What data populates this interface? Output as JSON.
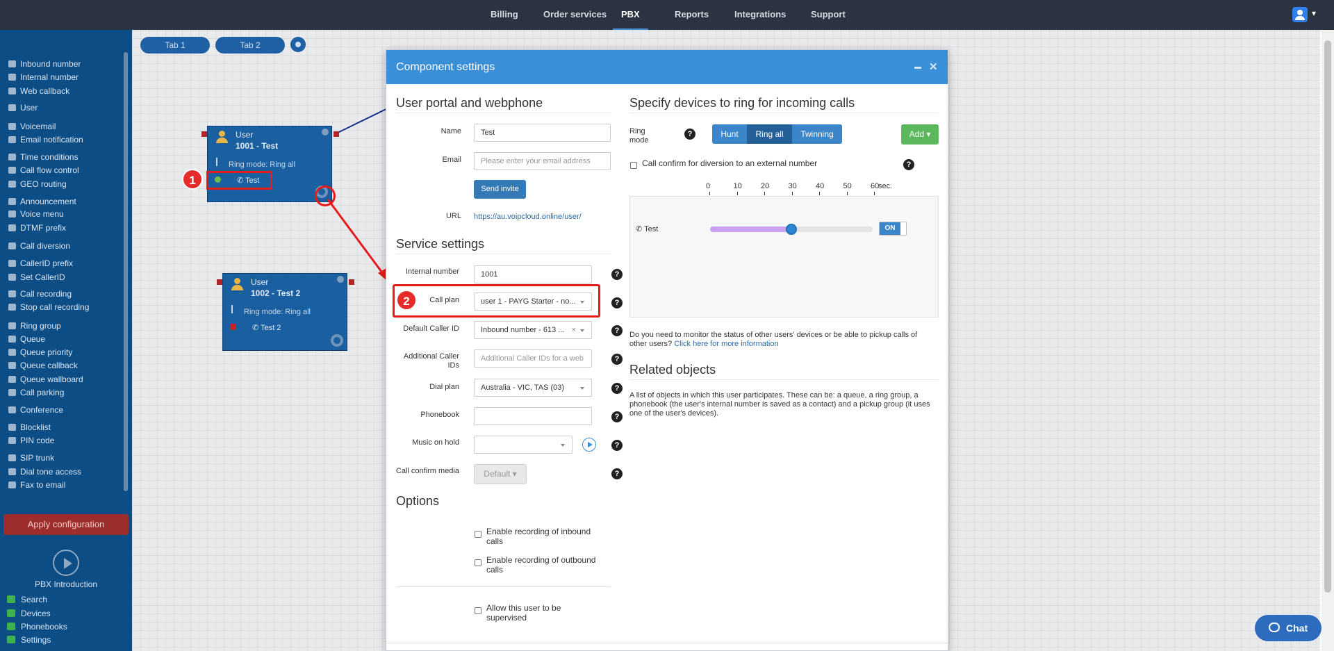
{
  "topnav": {
    "items": [
      "Billing",
      "Order services",
      "PBX",
      "Reports",
      "Integrations",
      "Support"
    ],
    "active": "PBX"
  },
  "sidebar": {
    "items": [
      "Inbound number",
      "Internal number",
      "Web callback",
      "User",
      "Voicemail",
      "Email notification",
      "Time conditions",
      "Call flow control",
      "GEO routing",
      "Announcement",
      "Voice menu",
      "DTMF prefix",
      "Call diversion",
      "CallerID prefix",
      "Set CallerID",
      "Call recording",
      "Stop call recording",
      "Ring group",
      "Queue",
      "Queue priority",
      "Queue callback",
      "Queue wallboard",
      "Call parking",
      "Conference",
      "Blocklist",
      "PIN code",
      "SIP trunk",
      "Dial tone access",
      "Fax to email"
    ],
    "apply_label": "Apply configuration",
    "intro_label": "PBX Introduction",
    "bottom_links": [
      "Search",
      "Devices",
      "Phonebooks",
      "Settings"
    ]
  },
  "canvas": {
    "tabs": [
      "Tab 1",
      "Tab 2"
    ],
    "nodes": [
      {
        "type": "User",
        "name": "1001 - Test",
        "ring_mode": "Ring mode: Ring all",
        "device": "Test",
        "status_color": "#6fbe44"
      },
      {
        "type": "User",
        "name": "1002 - Test 2",
        "ring_mode": "Ring mode: Ring all",
        "device": "Test 2",
        "status_color": "#c8232b"
      }
    ],
    "markers": [
      "1",
      "2"
    ]
  },
  "modal": {
    "title": "Component settings",
    "portal": {
      "heading": "User portal and webphone",
      "name_label": "Name",
      "name_value": "Test",
      "email_label": "Email",
      "email_placeholder": "Please enter your email address",
      "send_invite": "Send invite",
      "url_label": "URL",
      "url_value": "https://au.voipcloud.online/user/"
    },
    "service": {
      "heading": "Service settings",
      "internal_number_label": "Internal number",
      "internal_number_value": "1001",
      "call_plan_label": "Call plan",
      "call_plan_value": "user 1 - PAYG Starter - no...",
      "default_callerid_label": "Default Caller ID",
      "default_callerid_value": "Inbound number - 613 ...",
      "additional_callerids_label": "Additional Caller IDs",
      "additional_callerids_placeholder": "Additional Caller IDs for a web",
      "dial_plan_label": "Dial plan",
      "dial_plan_value": "Australia - VIC, TAS (03)",
      "phonebook_label": "Phonebook",
      "phonebook_value": "",
      "moh_label": "Music on hold",
      "moh_value": "",
      "confirm_media_label": "Call confirm media",
      "confirm_media_value": "Default"
    },
    "options": {
      "heading": "Options",
      "rec_inbound": "Enable recording of inbound calls",
      "rec_outbound": "Enable recording of outbound calls",
      "supervised": "Allow this user to be supervised"
    },
    "ring": {
      "heading": "Specify devices to ring for incoming calls",
      "mode_label": "Ring mode",
      "modes": [
        "Hunt",
        "Ring all",
        "Twinning"
      ],
      "active_mode": "Ring all",
      "add_label": "Add",
      "confirm_label": "Call confirm for diversion to an external number",
      "timeline": [
        "0",
        "10",
        "20",
        "30",
        "40",
        "50",
        "60"
      ],
      "timeline_unit": "sec.",
      "device_name": "Test",
      "device_ring_seconds": 30,
      "toggle_label": "ON",
      "monitor_text": "Do you need to monitor the status of other users' devices or be able to pickup calls of other users?",
      "monitor_link": "Click here for more information"
    },
    "related": {
      "heading": "Related objects",
      "text": "A list of objects in which this user participates. These can be: a queue, a ring group, a phonebook (the user's internal number is saved as a contact) and a pickup group (it uses one of the user's devices)."
    }
  },
  "chat": {
    "label": "Chat"
  },
  "colors": {
    "topnav": "#2b3340",
    "sidebar": "#0d4d86",
    "modal_header": "#3a8fd9",
    "marker": "#e62b2b",
    "apply": "#9d2d2b"
  }
}
